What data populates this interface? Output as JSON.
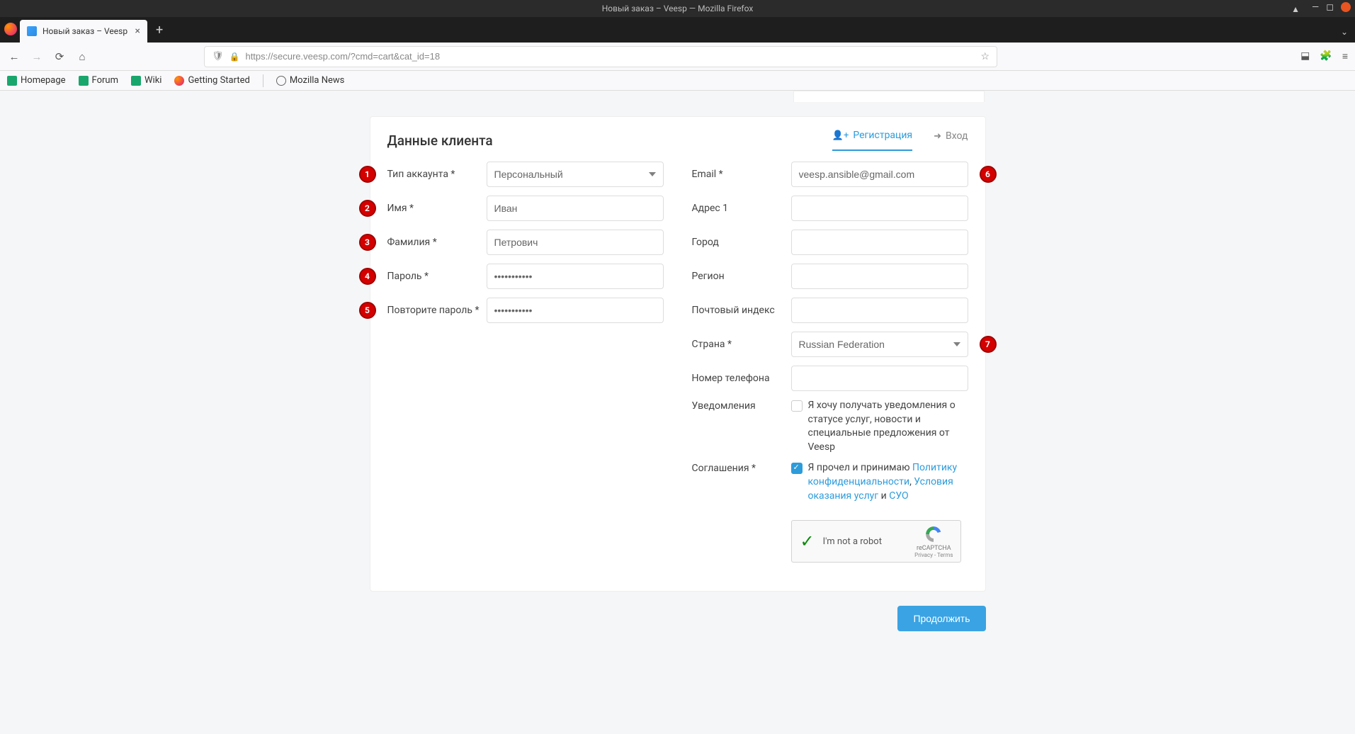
{
  "window": {
    "title": "Новый заказ – Veesp — Mozilla Firefox"
  },
  "tab": {
    "title": "Новый заказ – Veesp"
  },
  "url": "https://secure.veesp.com/?cmd=cart&cat_id=18",
  "bookmarks": [
    "Homepage",
    "Forum",
    "Wiki",
    "Getting Started",
    "Mozilla News"
  ],
  "card": {
    "heading": "Данные клиента",
    "tabs": {
      "register": "Регистрация",
      "login": "Вход"
    }
  },
  "labels": {
    "account_type": "Тип аккаунта *",
    "first_name": "Имя *",
    "last_name": "Фамилия *",
    "password": "Пароль *",
    "password2": "Повторите пароль *",
    "email": "Email *",
    "address1": "Адрес 1",
    "city": "Город",
    "region": "Регион",
    "postcode": "Почтовый индекс",
    "country": "Страна *",
    "phone": "Номер телефона",
    "notifications": "Уведомления",
    "agreements": "Соглашения *"
  },
  "values": {
    "account_type": "Персональный",
    "first_name": "Иван",
    "last_name": "Петрович",
    "password": "•••••••••••",
    "password2": "•••••••••••",
    "email": "veesp.ansible@gmail.com",
    "address1": "",
    "city": "",
    "region": "",
    "postcode": "",
    "country": "Russian Federation",
    "phone": ""
  },
  "notifications_text": "Я хочу получать уведомления о статусе услуг, новости и специальные предложения от Veesp",
  "agreements": {
    "prefix": "Я прочел и принимаю ",
    "privacy": "Политику конфиденциальности",
    "sep1": ", ",
    "terms": "Условия оказания услуг",
    "sep2": " и ",
    "syo": "СУО"
  },
  "recaptcha": {
    "text": "I'm not a robot",
    "brand": "reCAPTCHA",
    "sub": "Privacy - Terms"
  },
  "buttons": {
    "continue": "Продолжить"
  },
  "badges": {
    "1": "1",
    "2": "2",
    "3": "3",
    "4": "4",
    "5": "5",
    "6": "6",
    "7": "7"
  }
}
